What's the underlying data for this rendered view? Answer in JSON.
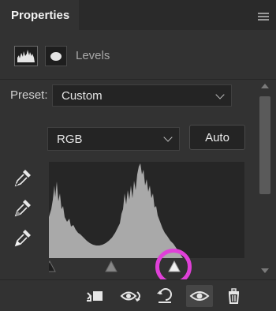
{
  "panel": {
    "tab_label": "Properties",
    "adjustment_title": "Levels"
  },
  "preset": {
    "label": "Preset:",
    "value": "Custom"
  },
  "channel": {
    "value": "RGB"
  },
  "auto_button": "Auto",
  "histogram": {
    "input_levels": {
      "black": 0,
      "gray": 1.0,
      "white": 172
    }
  },
  "icons": {
    "menu": "hamburger-menu-icon",
    "levels_adjustment": "histogram-icon",
    "mask": "mask-icon",
    "black_eyedropper": "eyedropper-icon",
    "gray_eyedropper": "eyedropper-icon",
    "white_eyedropper": "eyedropper-icon",
    "clip_to_layer": "clip-icon",
    "view_previous": "eye-previous-icon",
    "reset": "reset-icon",
    "toggle_visibility": "eye-icon",
    "delete": "trash-icon"
  },
  "colors": {
    "panel_bg": "#323232",
    "highlight": "#e040d8",
    "histogram_fill": "#a9a9a9"
  }
}
